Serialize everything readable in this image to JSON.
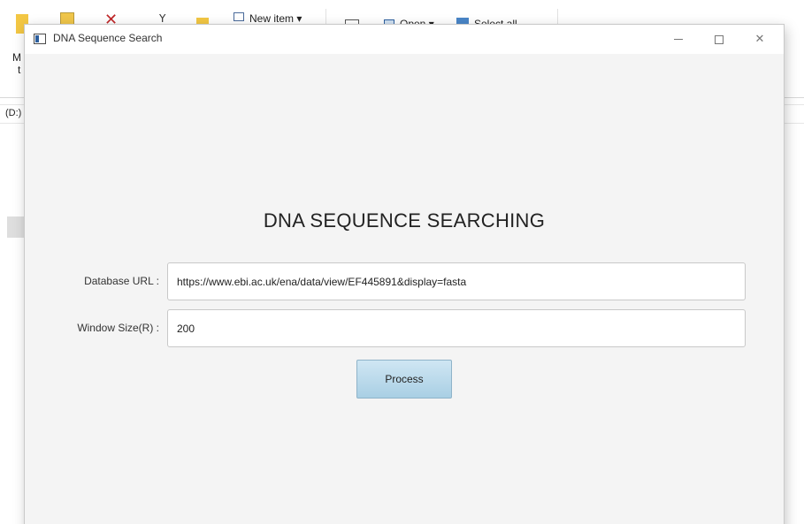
{
  "background_window": {
    "ribbon": {
      "new_item_label": "New item ▾",
      "open_label": "Open ▾",
      "select_all_label": "Select all",
      "truncated_left_top": "M",
      "truncated_left_bottom": "t"
    },
    "address_drive": "(D:)"
  },
  "window": {
    "title": "DNA Sequence Search",
    "controls": {
      "minimize": "—",
      "maximize": "☐",
      "close": "✕"
    }
  },
  "form": {
    "heading": "DNA SEQUENCE SEARCHING",
    "database_url": {
      "label": "Database URL :",
      "value": "https://www.ebi.ac.uk/ena/data/view/EF445891&display=fasta"
    },
    "window_size": {
      "label": "Window Size(R) :",
      "value": "200"
    },
    "process_button_label": "Process"
  },
  "colors": {
    "accent_button": "#b7d9ec",
    "window_background": "#f4f4f4"
  }
}
